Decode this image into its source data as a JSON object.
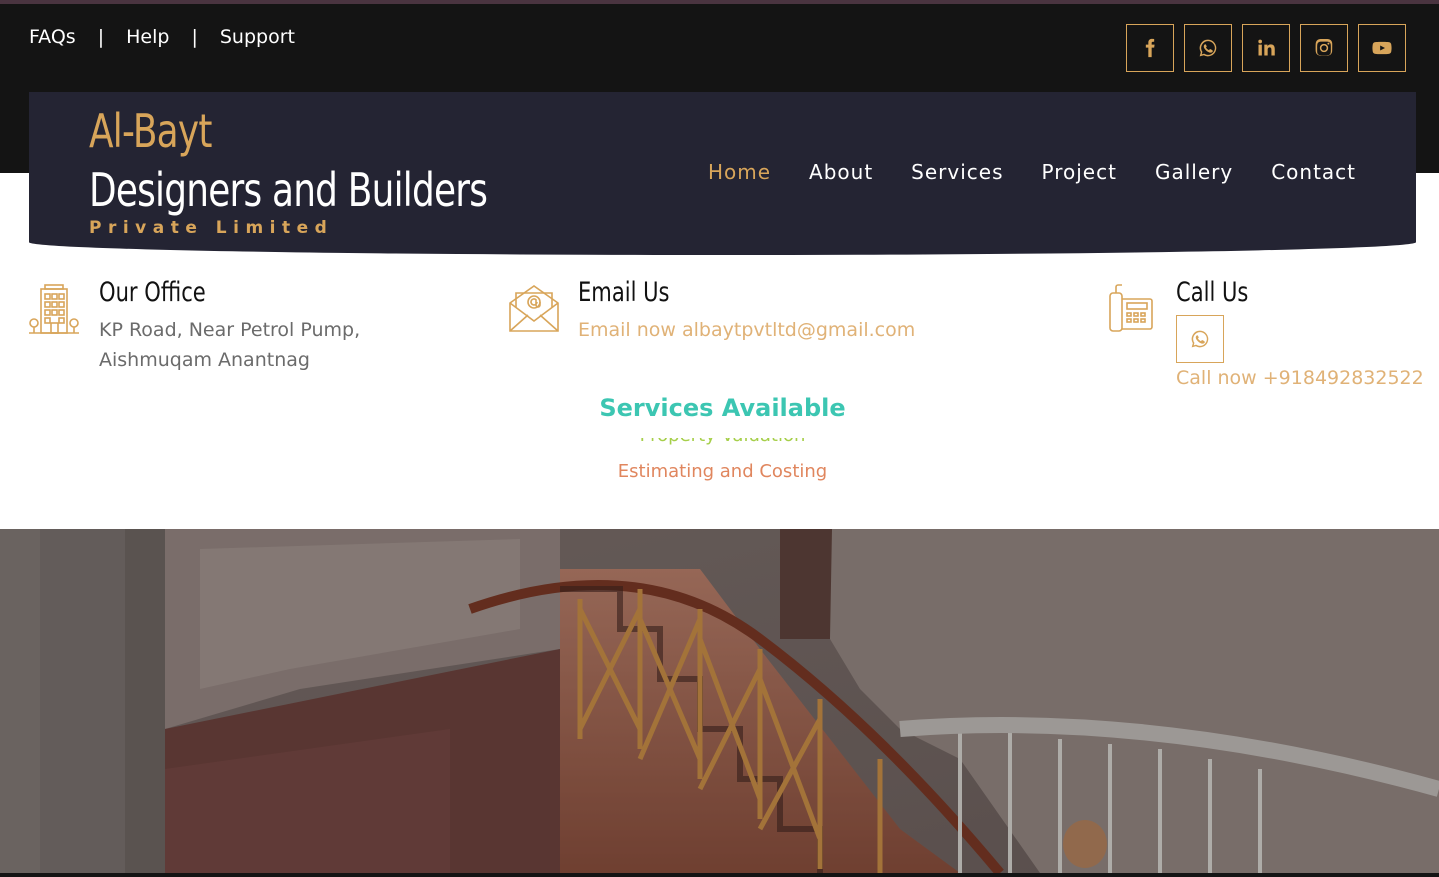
{
  "top_links": [
    "FAQs",
    "Help",
    "Support"
  ],
  "top_separator": "|",
  "socials": [
    "facebook-icon",
    "whatsapp-icon",
    "linkedin-icon",
    "instagram-icon",
    "youtube-icon"
  ],
  "brand": {
    "line1": "Al-Bayt",
    "line2": "Designers and Builders",
    "line3": "Private Limited"
  },
  "nav": {
    "items": [
      "Home",
      "About",
      "Services",
      "Project",
      "Gallery",
      "Contact"
    ],
    "active": "Home"
  },
  "office": {
    "title": "Our Office",
    "line1": "KP Road, Near Petrol Pump,",
    "line2": "Aishmuqam Anantnag",
    "icon": "building-icon"
  },
  "email": {
    "title": "Email Us",
    "text": "Email now albaytpvtltd@gmail.com",
    "icon": "envelope-icon"
  },
  "call": {
    "title": "Call Us",
    "text": "Call now +918492832522",
    "icon": "telephone-icon",
    "whatsapp_icon": "whatsapp-icon"
  },
  "services": {
    "title": "Services Available",
    "ticker": [
      "Property Valuation",
      "Estimating and Costing"
    ]
  },
  "colors": {
    "accent_gold": "#d8a55a",
    "nav_bg": "#242433",
    "topbar_bg": "#141414",
    "services_title": "#3cc6b2"
  }
}
